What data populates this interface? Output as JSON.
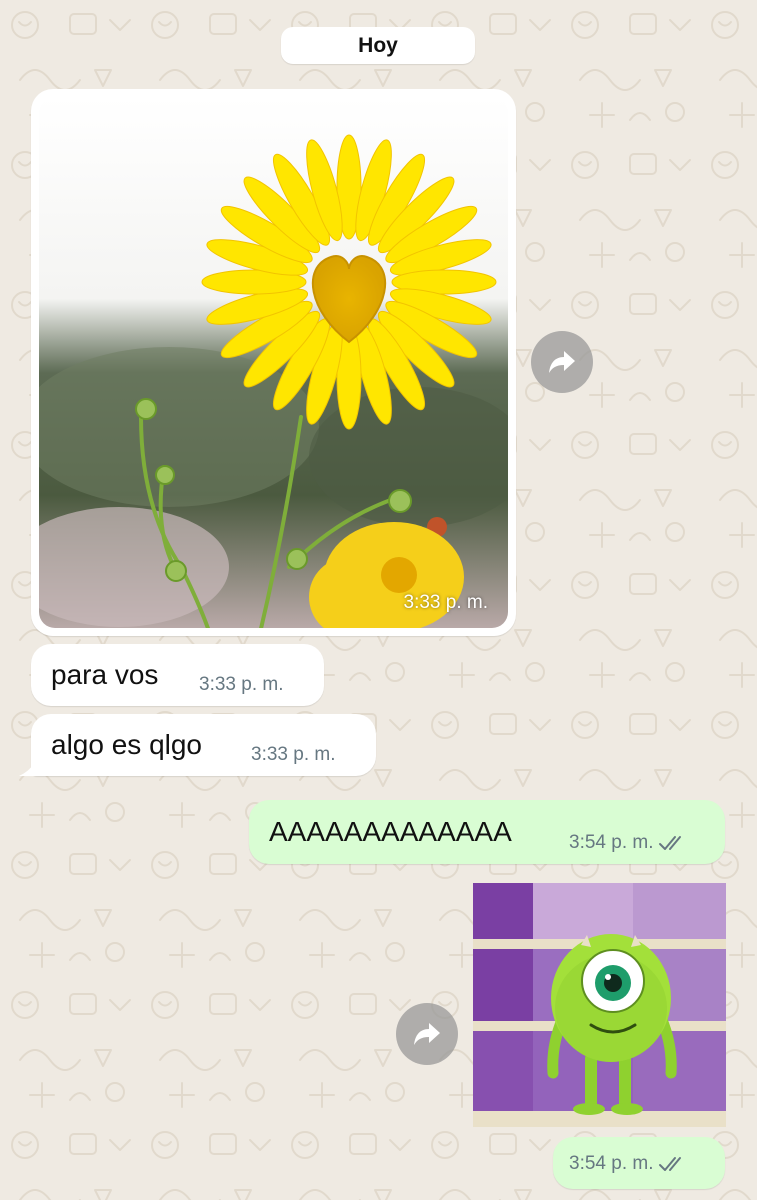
{
  "date_chip": "Hoy",
  "messages": [
    {
      "type": "image",
      "direction": "incoming",
      "description_icon": "daisy-photo",
      "time": "3:33 p. m."
    },
    {
      "type": "text",
      "direction": "incoming",
      "text": "para vos",
      "time": "3:33 p. m."
    },
    {
      "type": "text",
      "direction": "incoming",
      "text": "algo es qlgo",
      "time": "3:33 p. m."
    },
    {
      "type": "text",
      "direction": "outgoing",
      "text": "AAAAAAAAAAAAA",
      "time": "3:54 p. m.",
      "status": "read"
    },
    {
      "type": "sticker",
      "direction": "outgoing",
      "description_icon": "mike-wazowski-sticker",
      "time": "3:54 p. m.",
      "status": "read"
    }
  ],
  "icons": {
    "forward": "forward-arrow-icon",
    "read_receipt": "double-check-icon"
  },
  "colors": {
    "background": "#efeae2",
    "incoming_bubble": "#ffffff",
    "outgoing_bubble": "#d9fdd3",
    "meta_text": "#667781"
  }
}
